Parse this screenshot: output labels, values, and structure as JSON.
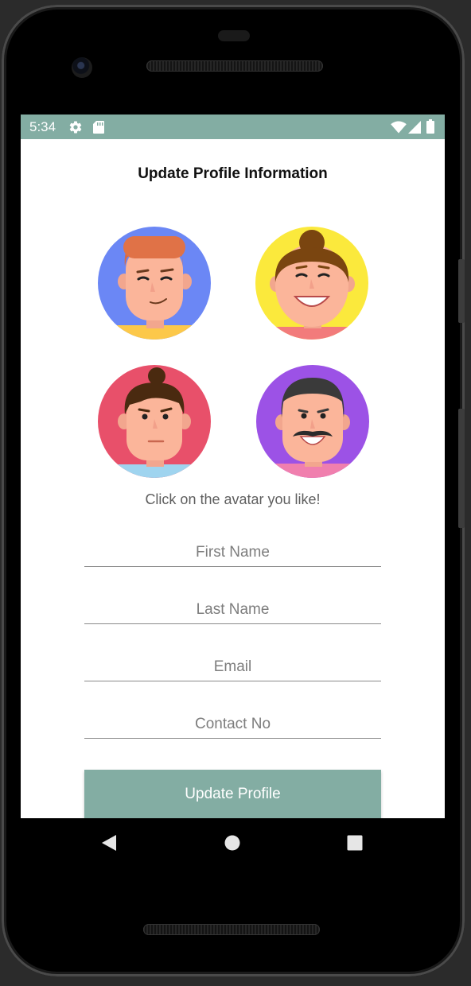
{
  "status_bar": {
    "time": "5:34",
    "left_icons": [
      "settings-gear-icon",
      "sd-card-icon"
    ],
    "right_icons": [
      "wifi-icon",
      "signal-icon",
      "battery-icon"
    ],
    "color": "#83ada3"
  },
  "page": {
    "title": "Update Profile Information",
    "hint": "Click on the avatar you like!"
  },
  "avatars": [
    {
      "name": "avatar-man-red-hair",
      "bg": "#6b87f5"
    },
    {
      "name": "avatar-woman-bun",
      "bg": "#fbe93c"
    },
    {
      "name": "avatar-man-topknot",
      "bg": "#e8506a"
    },
    {
      "name": "avatar-man-mustache",
      "bg": "#9c52e6"
    }
  ],
  "form": {
    "first_name": {
      "placeholder": "First Name",
      "value": ""
    },
    "last_name": {
      "placeholder": "Last Name",
      "value": ""
    },
    "email": {
      "placeholder": "Email",
      "value": ""
    },
    "contact": {
      "placeholder": "Contact No",
      "value": ""
    }
  },
  "buttons": {
    "update_label": "Update Profile"
  },
  "nav_bar": {
    "icons": [
      "back-icon",
      "home-icon",
      "recents-icon"
    ]
  },
  "colors": {
    "accent": "#83ada3",
    "text_dark": "#111111",
    "hint_text": "#5f5f5f"
  }
}
